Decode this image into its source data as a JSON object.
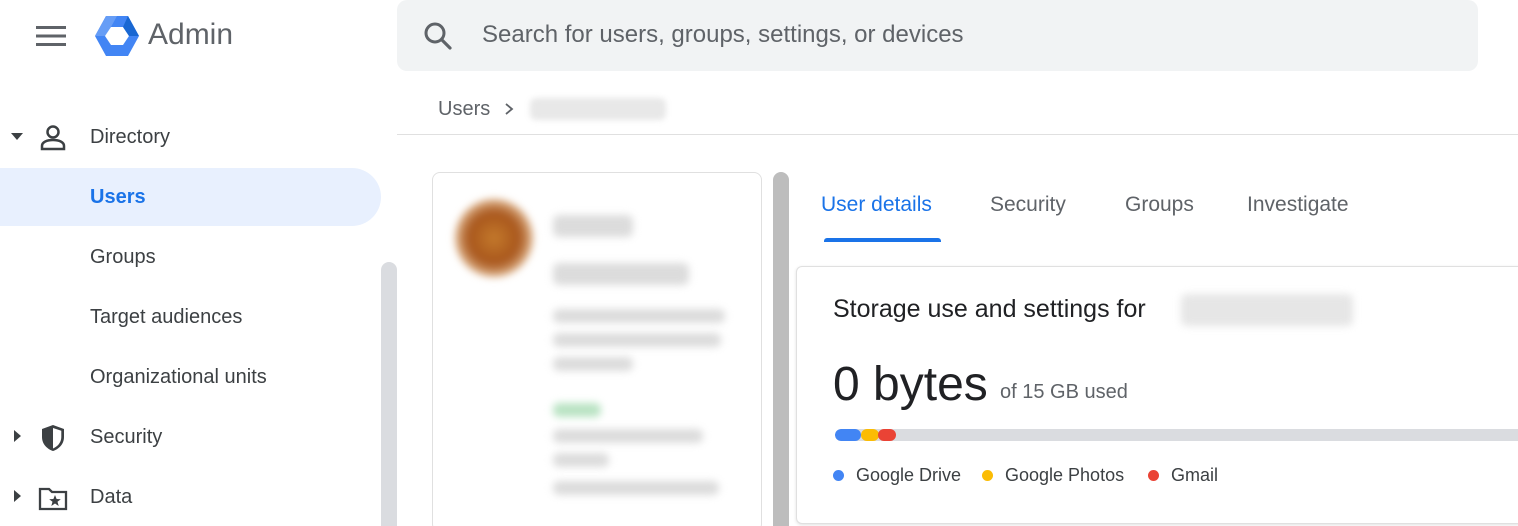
{
  "header": {
    "app_title": "Admin",
    "search_placeholder": "Search for users, groups, settings, or devices"
  },
  "breadcrumb": {
    "root": "Users"
  },
  "sidebar": {
    "items": [
      {
        "label": "Directory",
        "icon": "person-icon",
        "expanded": true
      },
      {
        "label": "Users",
        "active": true
      },
      {
        "label": "Groups"
      },
      {
        "label": "Target audiences"
      },
      {
        "label": "Organizational units"
      },
      {
        "label": "Security",
        "icon": "shield-icon",
        "expanded": false
      },
      {
        "label": "Data",
        "icon": "folder-star-icon",
        "expanded": false
      }
    ]
  },
  "tabs": [
    {
      "label": "User details",
      "active": true
    },
    {
      "label": "Security"
    },
    {
      "label": "Groups"
    },
    {
      "label": "Investigate"
    }
  ],
  "storage": {
    "title": "Storage use and settings for",
    "amount": "0 bytes",
    "of_label": "of 15 GB used",
    "legend": [
      {
        "label": "Google Drive",
        "color": "#4285f4"
      },
      {
        "label": "Google Photos",
        "color": "#fbbc04"
      },
      {
        "label": "Gmail",
        "color": "#ea4335"
      }
    ]
  },
  "colors": {
    "accent": "#1a73e8",
    "active_nav_bg": "#e8f0fe",
    "search_bg": "#f1f3f4"
  }
}
